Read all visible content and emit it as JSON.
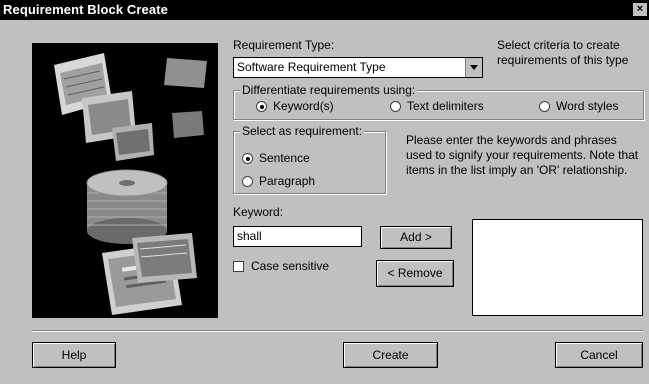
{
  "window": {
    "title": "Requirement Block Create",
    "close_label": "×"
  },
  "requirement_type": {
    "label": "Requirement Type:",
    "selected": "Software Requirement Type",
    "hint": "Select criteria to create requirements of this type"
  },
  "differentiate": {
    "label": "Differentiate requirements using:",
    "options": [
      {
        "label": "Keyword(s)",
        "selected": true
      },
      {
        "label": "Text delimiters",
        "selected": false
      },
      {
        "label": "Word styles",
        "selected": false
      }
    ]
  },
  "select_as": {
    "label": "Select as requirement:",
    "options": [
      {
        "label": "Sentence",
        "selected": true
      },
      {
        "label": "Paragraph",
        "selected": false
      }
    ]
  },
  "info_text": "Please enter the keywords and phrases used to signify your requirements. Note that items in the list imply an 'OR' relationship.",
  "keyword": {
    "label": "Keyword:",
    "value": "shall"
  },
  "case_sensitive": {
    "label": "Case sensitive",
    "checked": false
  },
  "buttons": {
    "add": "Add >",
    "remove": "< Remove",
    "help": "Help",
    "create": "Create",
    "cancel": "Cancel"
  },
  "keyword_list": []
}
